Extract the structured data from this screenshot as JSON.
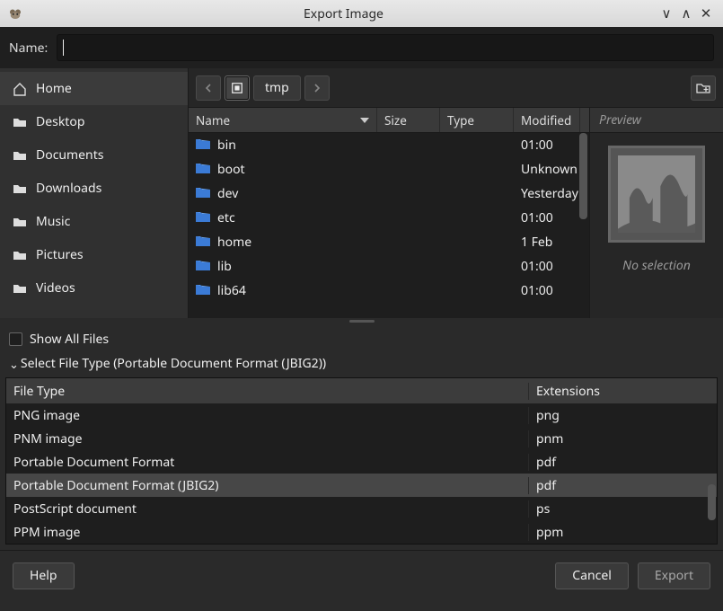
{
  "window": {
    "title": "Export Image"
  },
  "name_field": {
    "label": "Name:",
    "value": ""
  },
  "places": [
    {
      "id": "home",
      "label": "Home",
      "icon": "home",
      "active": true
    },
    {
      "id": "desktop",
      "label": "Desktop",
      "icon": "folder",
      "active": false
    },
    {
      "id": "documents",
      "label": "Documents",
      "icon": "folder",
      "active": false
    },
    {
      "id": "downloads",
      "label": "Downloads",
      "icon": "folder",
      "active": false
    },
    {
      "id": "music",
      "label": "Music",
      "icon": "folder",
      "active": false
    },
    {
      "id": "pictures",
      "label": "Pictures",
      "icon": "folder",
      "active": false
    },
    {
      "id": "videos",
      "label": "Videos",
      "icon": "folder",
      "active": false
    }
  ],
  "path": {
    "segments": [
      "tmp"
    ]
  },
  "columns": {
    "name": "Name",
    "size": "Size",
    "type": "Type",
    "modified": "Modified",
    "preview": "Preview"
  },
  "files": [
    {
      "name": "bin",
      "size": "",
      "type": "",
      "modified": "01:00"
    },
    {
      "name": "boot",
      "size": "",
      "type": "",
      "modified": "Unknown"
    },
    {
      "name": "dev",
      "size": "",
      "type": "",
      "modified": "Yesterday"
    },
    {
      "name": "etc",
      "size": "",
      "type": "",
      "modified": "01:00"
    },
    {
      "name": "home",
      "size": "",
      "type": "",
      "modified": "1 Feb"
    },
    {
      "name": "lib",
      "size": "",
      "type": "",
      "modified": "01:00"
    },
    {
      "name": "lib64",
      "size": "",
      "type": "",
      "modified": "01:00"
    }
  ],
  "preview": {
    "label": "No selection"
  },
  "options": {
    "show_all_files": {
      "label": "Show All Files",
      "checked": false
    },
    "file_type_expander": "Select File Type (Portable Document Format (JBIG2))"
  },
  "type_table": {
    "headers": {
      "file_type": "File Type",
      "extensions": "Extensions"
    },
    "rows": [
      {
        "file_type": "PNG image",
        "ext": "png",
        "selected": false
      },
      {
        "file_type": "PNM image",
        "ext": "pnm",
        "selected": false
      },
      {
        "file_type": "Portable Document Format",
        "ext": "pdf",
        "selected": false
      },
      {
        "file_type": "Portable Document Format (JBIG2)",
        "ext": "pdf",
        "selected": true
      },
      {
        "file_type": "PostScript document",
        "ext": "ps",
        "selected": false
      },
      {
        "file_type": "PPM image",
        "ext": "ppm",
        "selected": false
      }
    ]
  },
  "buttons": {
    "help": "Help",
    "cancel": "Cancel",
    "export": "Export"
  }
}
